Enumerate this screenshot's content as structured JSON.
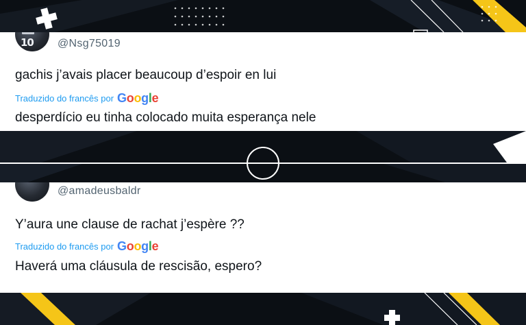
{
  "colors": {
    "background": "#0b0f14",
    "accent_yellow": "#f5c518",
    "card": "#ffffff",
    "handle_gray": "#536471",
    "link_blue": "#1d9bf0"
  },
  "tweets": [
    {
      "handle": "@Nsg75019",
      "avatar_jersey": "10",
      "original": "gachis j’avais placer beaucoup d’espoir en lui",
      "translated_by_label": "Traduzido do francês por",
      "translation": "desperdício eu tinha colocado muita esperança nele"
    },
    {
      "handle": "@amadeusbaldr",
      "original": "Y’aura une clause de rachat j’espère ??",
      "translated_by_label": "Traduzido do francês por",
      "translation": "Haverá uma cláusula de rescisão, espero?"
    }
  ],
  "google": {
    "letters": [
      "G",
      "o",
      "o",
      "g",
      "l",
      "e"
    ],
    "colors": [
      "#4285f4",
      "#ea4335",
      "#fbbc05",
      "#4285f4",
      "#34a853",
      "#ea4335"
    ]
  }
}
